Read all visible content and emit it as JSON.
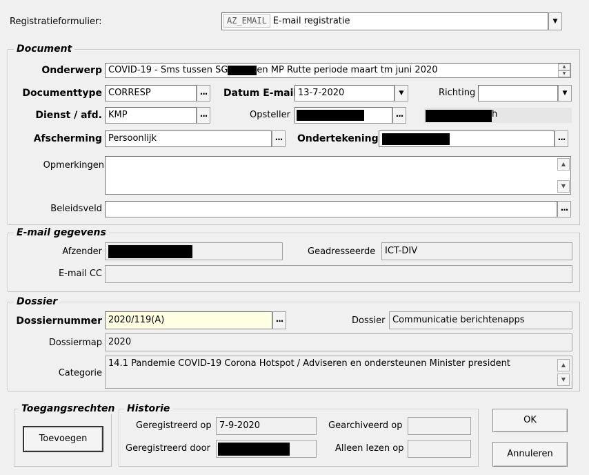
{
  "header": {
    "form_label": "Registratieformulier:",
    "form_code": "AZ_EMAIL",
    "form_value": "E-mail registratie"
  },
  "document": {
    "title": "Document",
    "onderwerp_label": "Onderwerp",
    "onderwerp_value_part1": "COVID-19 - Sms tussen SG",
    "onderwerp_value_part2": "en MP Rutte periode maart tm juni 2020",
    "documenttype_label": "Documenttype",
    "documenttype_value": "CORRESP",
    "datum_label": "Datum E-mail",
    "datum_value": "13-7-2020",
    "richting_label": "Richting",
    "richting_value": "",
    "dienst_label": "Dienst / afd.",
    "dienst_value": "KMP",
    "opsteller_label": "Opsteller",
    "opsteller_suffix": "h",
    "afscherming_label": "Afscherming",
    "afscherming_value": "Persoonlijk",
    "ondertekening_label": "Ondertekening",
    "opmerkingen_label": "Opmerkingen",
    "opmerkingen_value": "",
    "beleidsveld_label": "Beleidsveld",
    "beleidsveld_value": "",
    "dots": "..."
  },
  "email": {
    "title": "E-mail gegevens",
    "afzender_label": "Afzender",
    "geadresseerde_label": "Geadresseerde",
    "geadresseerde_value": "ICT-DIV",
    "cc_label": "E-mail CC",
    "cc_value": ""
  },
  "dossier": {
    "title": "Dossier",
    "nummer_label": "Dossiernummer",
    "nummer_value": "2020/119(A)",
    "dossier_label": "Dossier",
    "dossier_value": "Communicatie berichtenapps",
    "map_label": "Dossiermap",
    "map_value": "2020",
    "categorie_label": "Categorie",
    "categorie_value": "14.1 Pandemie COVID-19 Corona Hotspot / Adviseren en ondersteunen Minister president"
  },
  "toegang": {
    "title": "Toegangsrechten",
    "button": "Toevoegen"
  },
  "historie": {
    "title": "Historie",
    "geregistreerd_op_label": "Geregistreerd op",
    "geregistreerd_op_value": "7-9-2020",
    "gearchiveerd_label": "Gearchiveerd op",
    "gearchiveerd_value": "",
    "geregistreerd_door_label": "Geregistreerd door",
    "alleen_lezen_label": "Alleen lezen op",
    "alleen_lezen_value": ""
  },
  "buttons": {
    "ok": "OK",
    "cancel": "Annuleren"
  },
  "icons": {
    "dropdown": "chevron-down-icon",
    "scroll_up": "scroll-up-icon",
    "scroll_down": "scroll-down-icon"
  }
}
